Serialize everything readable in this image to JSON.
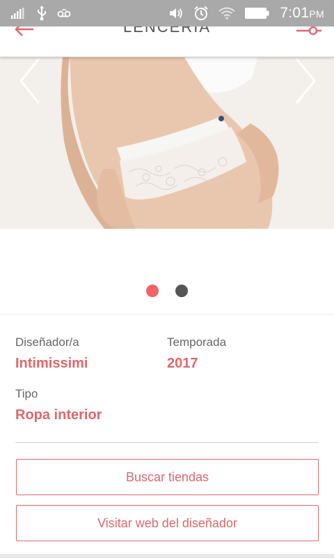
{
  "colors": {
    "accent": "#e0676b",
    "status_bar": "#a9a9a9",
    "dot_active": "#f06366",
    "dot_inactive": "#555555"
  },
  "status_bar": {
    "time": "7:01",
    "ampm": "PM",
    "icons_left": [
      "signal-bars-icon",
      "usb-icon",
      "voicemail-icon"
    ],
    "icons_right": [
      "volume-icon",
      "alarm-icon",
      "wifi-icon",
      "battery-icon"
    ]
  },
  "header": {
    "title": "LENCERIA",
    "back_icon": "back-arrow-icon",
    "filter_icon": "filter-slider-icon"
  },
  "gallery": {
    "image": "product-photo-lace-garter",
    "total_slides": 2,
    "active_slide": 1
  },
  "details": {
    "designer_label": "Diseñador/a",
    "designer_value": "Intimissimi",
    "season_label": "Temporada",
    "season_value": "2017",
    "type_label": "Tipo",
    "type_value": "Ropa interior"
  },
  "actions": {
    "find_stores": "Buscar tiendas",
    "visit_web": "Visitar web del diseñador"
  }
}
